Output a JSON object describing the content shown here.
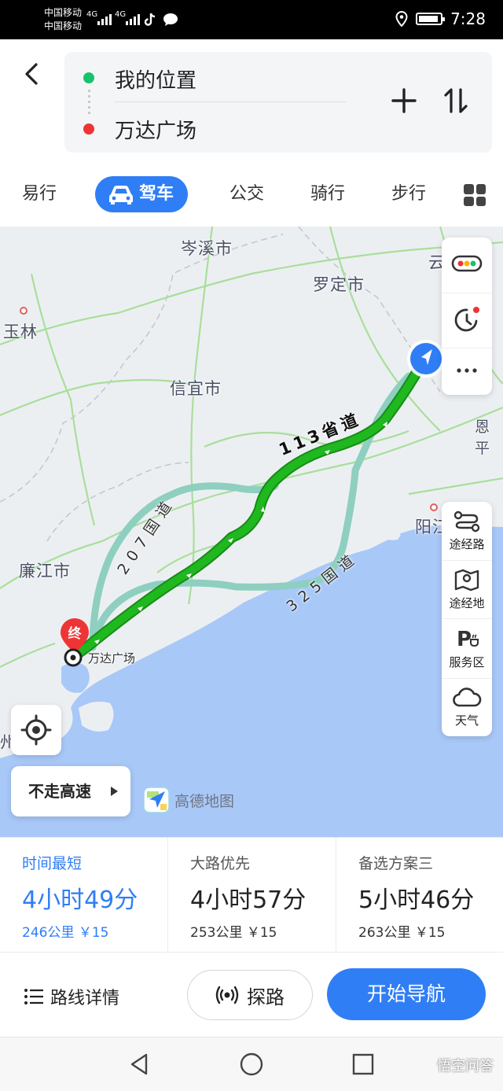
{
  "status_bar": {
    "carrier_1": "中国移动",
    "carrier_2": "中国移动",
    "network_1": "4G",
    "network_2": "4G",
    "time": "7:28"
  },
  "header": {
    "from": "我的位置",
    "to": "万达广场"
  },
  "tabs": [
    {
      "label": "易行"
    },
    {
      "label": "驾车"
    },
    {
      "label": "公交"
    },
    {
      "label": "骑行"
    },
    {
      "label": "步行"
    }
  ],
  "map": {
    "cities": [
      "岑溪市",
      "罗定市",
      "玉林",
      "信宜市",
      "廉江市",
      "阳江",
      "云",
      "恩平",
      "州"
    ],
    "road_labels": {
      "s113": "113省道",
      "g207": "207国道",
      "g325": "325国道"
    },
    "destination_marker": "终",
    "destination_label": "万达广场",
    "side_tools": [
      {
        "label": "途经路"
      },
      {
        "label": "途经地"
      },
      {
        "label": "服务区"
      },
      {
        "label": "天气"
      }
    ],
    "no_highway_label": "不走高速",
    "brand": "高德地图"
  },
  "routes": [
    {
      "name": "时间最短",
      "time": "4小时49分",
      "meta": "246公里 ￥15",
      "selected": true
    },
    {
      "name": "大路优先",
      "time": "4小时57分",
      "meta": "253公里 ￥15",
      "selected": false
    },
    {
      "name": "备选方案三",
      "time": "5小时46分",
      "meta": "263公里 ￥15",
      "selected": false
    }
  ],
  "actions": {
    "details": "路线详情",
    "probe": "探路",
    "start": "开始导航"
  },
  "watermark": "悟空问答",
  "colors": {
    "accent": "#2f7ef5",
    "route_main": "#1fb81f",
    "route_alt": "#8ecfc0",
    "sea": "#a8c8f8",
    "start_dot": "#15c36b",
    "end_dot": "#ee3434"
  }
}
